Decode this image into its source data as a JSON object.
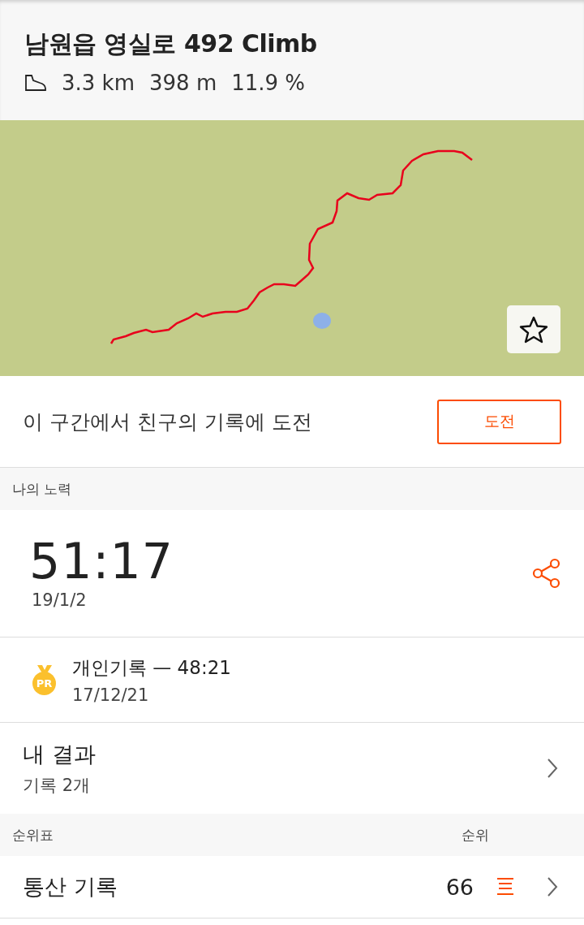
{
  "segment": {
    "title": "남원읍 영실로 492 Climb",
    "distance": "3.3 km",
    "elevation": "398 m",
    "grade": "11.9 %"
  },
  "challenge": {
    "text": "이 구간에서 친구의 기록에 도전",
    "button": "도전"
  },
  "my_effort": {
    "header": "나의 노력",
    "time": "51:17",
    "date": "19/1/2"
  },
  "pr": {
    "badge": "PR",
    "label": "개인기록 — 48:21",
    "date": "17/12/21"
  },
  "results": {
    "title": "내 결과",
    "subtitle": "기록 2개"
  },
  "leaderboard": {
    "header": "순위표",
    "rank_header": "순위",
    "rows": [
      {
        "label": "통산 기록",
        "rank": "66"
      }
    ]
  }
}
